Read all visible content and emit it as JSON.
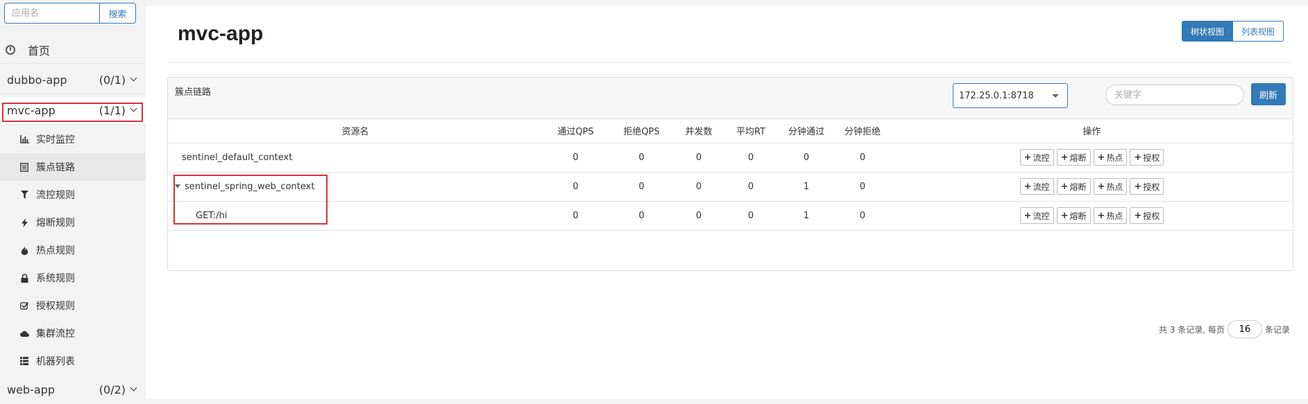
{
  "sidebar": {
    "search_placeholder": "应用名",
    "search_button": "搜索",
    "home_label": "首页",
    "apps": [
      {
        "name": "dubbo-app",
        "count": "(0/1)"
      },
      {
        "name": "mvc-app",
        "count": "(1/1)"
      },
      {
        "name": "web-app",
        "count": "(0/2)"
      }
    ],
    "submenu": [
      {
        "label": "实时监控",
        "icon": "bar-chart-icon"
      },
      {
        "label": "簇点链路",
        "icon": "list-icon"
      },
      {
        "label": "流控规则",
        "icon": "filter-icon"
      },
      {
        "label": "熔断规则",
        "icon": "flash-icon"
      },
      {
        "label": "热点规则",
        "icon": "fire-icon"
      },
      {
        "label": "系统规则",
        "icon": "lock-icon"
      },
      {
        "label": "授权规则",
        "icon": "check-icon"
      },
      {
        "label": "集群流控",
        "icon": "cloud-icon"
      },
      {
        "label": "机器列表",
        "icon": "th-list-icon"
      }
    ]
  },
  "main": {
    "title": "mvc-app",
    "view_toggle": {
      "tree": "树状视图",
      "list": "列表视图"
    },
    "panel_title": "簇点链路",
    "machine": "172.25.0.1:8718",
    "keyword_placeholder": "关键字",
    "refresh": "刷新",
    "table": {
      "headers": [
        "资源名",
        "通过QPS",
        "拒绝QPS",
        "并发数",
        "平均RT",
        "分钟通过",
        "分钟拒绝",
        "操作"
      ],
      "rows": [
        {
          "name": "sentinel_default_context",
          "pass_qps": "0",
          "block_qps": "0",
          "threads": "0",
          "avg_rt": "0",
          "minute_pass": "0",
          "minute_block": "0"
        },
        {
          "name": "sentinel_spring_web_context",
          "pass_qps": "0",
          "block_qps": "0",
          "threads": "0",
          "avg_rt": "0",
          "minute_pass": "1",
          "minute_block": "0"
        },
        {
          "name": "GET:/hi",
          "pass_qps": "0",
          "block_qps": "0",
          "threads": "0",
          "avg_rt": "0",
          "minute_pass": "1",
          "minute_block": "0"
        }
      ],
      "ops": [
        "流控",
        "熔断",
        "热点",
        "授权"
      ]
    },
    "pager": {
      "prefix": "共 3 条记录, 每页",
      "page_size": "16",
      "suffix": "条记录"
    }
  },
  "colors": {
    "primary": "#337ab7",
    "highlight": "#d9303a"
  }
}
